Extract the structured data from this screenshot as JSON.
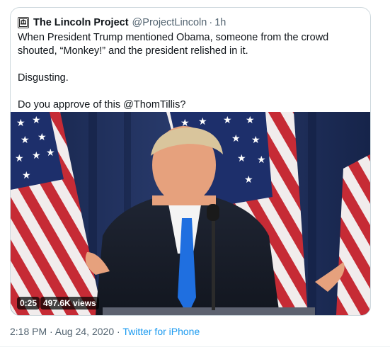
{
  "quoted_tweet": {
    "display_name": "The Lincoln Project",
    "handle": "@ProjectLincoln",
    "separator": "·",
    "timestamp": "1h",
    "text_paragraphs": [
      "When President Trump mentioned Obama, someone from the crowd shouted, “Monkey!” and the president relished in it.",
      "Disgusting.",
      "Do you approve of this @ThomTillis?"
    ],
    "avatar_icon": "lincoln-project-logo-icon"
  },
  "video": {
    "duration": "0:25",
    "views": "497.6K views"
  },
  "footer": {
    "datetime": "2:18 PM · Aug 24, 2020",
    "separator": "·",
    "source": "Twitter for iPhone"
  },
  "colors": {
    "link": "#1d9bf0",
    "secondary_text": "#536471",
    "border": "#cfd9de"
  }
}
